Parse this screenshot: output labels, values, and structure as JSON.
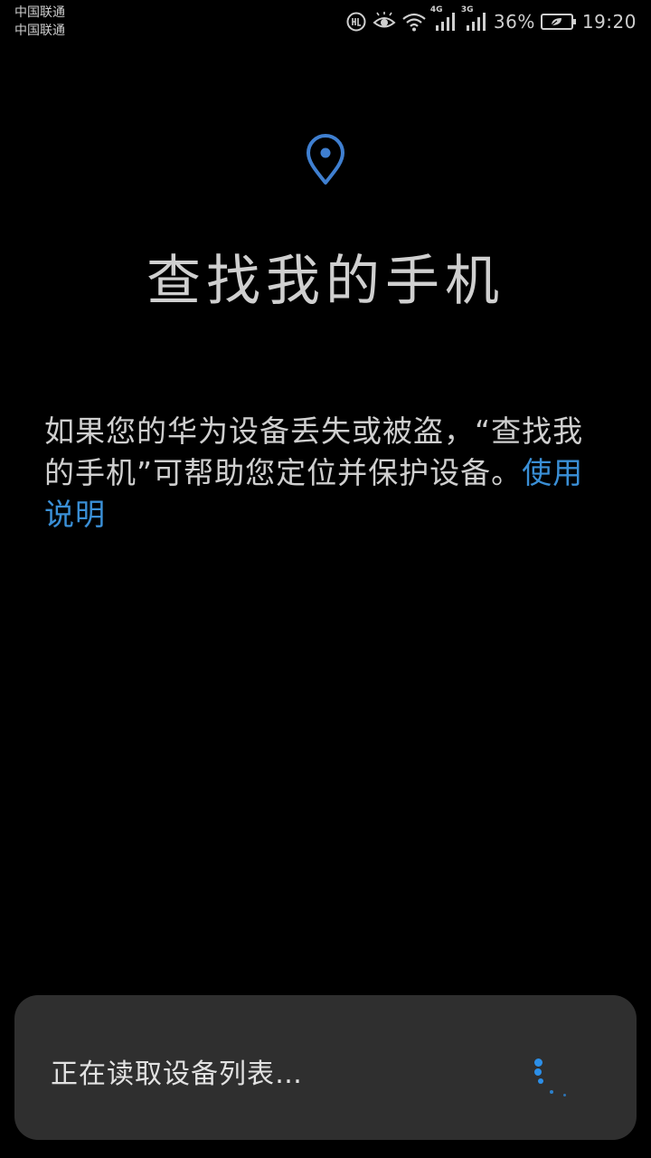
{
  "status_bar": {
    "carrier_1": "中国联通",
    "carrier_2": "中国联通",
    "net_type_1": "4G",
    "net_type_2": "3G",
    "battery_percent": "36%",
    "time": "19:20",
    "icons": [
      "hd-call-icon",
      "eye-comfort-icon",
      "wifi-icon",
      "signal-4g-icon",
      "signal-3g-icon",
      "battery-saver-icon"
    ]
  },
  "main": {
    "pin_icon": "location-pin-icon",
    "title": "查找我的手机",
    "description": "如果您的华为设备丢失或被盗，“查找我的手机”可帮助您定位并保护设备。",
    "help_link": "使用说明"
  },
  "dialog": {
    "message": "正在读取设备列表…",
    "spinner_icon": "loading-spinner-icon"
  },
  "colors": {
    "background": "#000000",
    "text": "#cfcfcf",
    "accent": "#3a8fd6",
    "pin": "#3f7fd0",
    "dialog_bg": "#2f2f2f",
    "spinner": "#2c8fe8"
  }
}
